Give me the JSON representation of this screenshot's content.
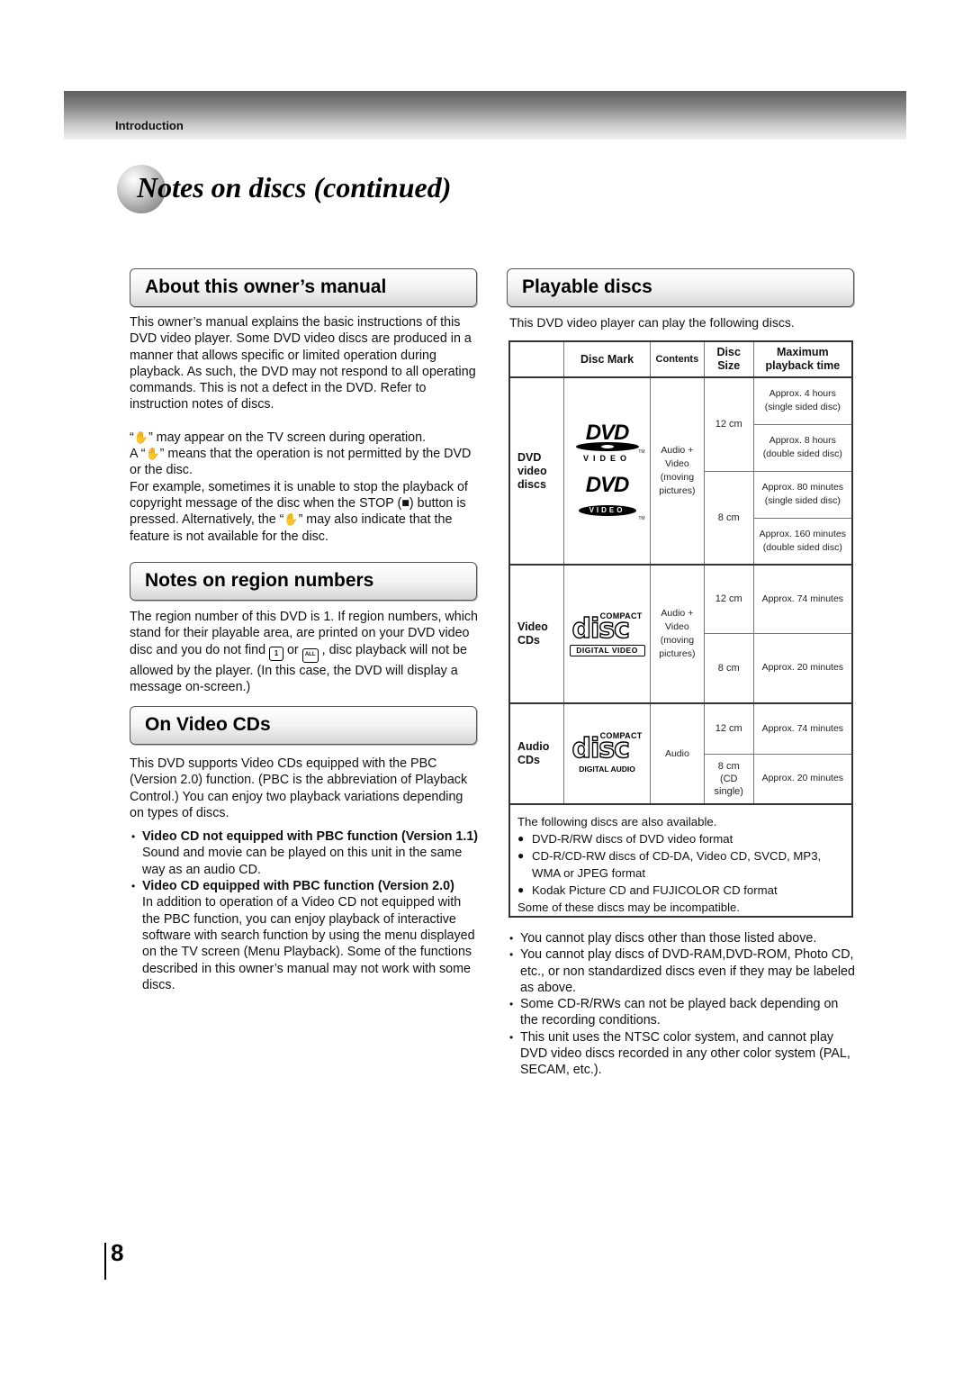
{
  "header": {
    "section_label": "Introduction",
    "page_title": "Notes on discs (continued)"
  },
  "about_manual": {
    "heading": "About this owner’s manual",
    "para1": "This owner’s manual explains the basic instructions of this DVD video player. Some DVD video discs are produced in a manner that allows specific or limited operation during playback. As such, the DVD may not respond to all operating commands. This is not a defect in the DVD. Refer to instruction notes of discs.",
    "hand_icon": "prohibited-hand-icon",
    "line1_pre": "“",
    "line1_post": "” may appear on the TV screen during operation.",
    "line2_pre": "A “",
    "line2_post": "” means that the operation is not permitted by the DVD or the disc.",
    "line3_pre": "For example, sometimes it is unable to stop the playback of copyright message of the disc when the STOP (",
    "stop_icon": "stop-square-icon",
    "line3_mid": ") button is pressed. Alternatively, the “",
    "line3_post": "” may also indicate that the feature is not available for the disc."
  },
  "region": {
    "heading": "Notes on region numbers",
    "text_pre": "The region number of this DVD is 1. If region numbers, which stand for their playable area, are printed on your DVD video disc and you do not find ",
    "region1_icon": "region-1-globe-icon",
    "region1_label": "1",
    "text_or": " or ",
    "regionall_icon": "region-all-globe-icon",
    "regionall_label": "ALL",
    "text_post": " , disc playback will not be allowed by the player. (In this case, the DVD will display a message on-screen.)"
  },
  "video_cds": {
    "heading": "On Video CDs",
    "intro": "This DVD supports Video CDs equipped with the PBC (Version 2.0) function. (PBC is the abbreviation of Playback Control.) You can enjoy two playback variations depending on types of discs.",
    "items": [
      {
        "title": "Video CD not equipped with PBC function (Version 1.1)",
        "desc": "Sound and movie can be played on this unit in the same way as an audio CD."
      },
      {
        "title": "Video CD equipped with PBC function (Version 2.0)",
        "desc": "In addition to operation of a Video CD not equipped with the PBC function, you can enjoy playback of interactive software with search function by using the menu displayed on the TV screen (Menu Playback). Some of the functions described in this owner’s manual may not work with some discs."
      }
    ]
  },
  "playable": {
    "heading": "Playable discs",
    "intro": "This DVD video player can play the following discs.",
    "table": {
      "headers": [
        "",
        "Disc Mark",
        "Contents",
        "Disc Size",
        "Maximum playback time"
      ],
      "groups": [
        {
          "type": "DVD video discs",
          "logo": "dvd-video-logo",
          "logo_text": "DVD",
          "logo_sub": "VIDEO",
          "logo_tm": "TM",
          "contents": "Audio + Video (moving pictures)",
          "sizes": [
            {
              "size": "12 cm",
              "times": [
                "Approx. 4 hours (single sided disc)",
                "Approx. 8 hours (double sided disc)"
              ]
            },
            {
              "size": "8 cm",
              "times": [
                "Approx. 80 minutes (single sided disc)",
                "Approx. 160 minutes (double sided disc)"
              ]
            }
          ]
        },
        {
          "type": "Video CDs",
          "logo": "compact-disc-digital-video-logo",
          "logo_top": "COMPACT",
          "logo_text": "disc",
          "logo_sub": "DIGITAL VIDEO",
          "contents": "Audio + Video (moving pictures)",
          "sizes": [
            {
              "size": "12 cm",
              "times": [
                "Approx. 74 minutes"
              ]
            },
            {
              "size": "8 cm",
              "times": [
                "Approx. 20 minutes"
              ]
            }
          ]
        },
        {
          "type": "Audio CDs",
          "logo": "compact-disc-digital-audio-logo",
          "logo_top": "COMPACT",
          "logo_text": "disc",
          "logo_sub": "DIGITAL AUDIO",
          "contents": "Audio",
          "sizes": [
            {
              "size": "12 cm",
              "times": [
                "Approx. 74 minutes"
              ]
            },
            {
              "size": "8 cm (CD single)",
              "times": [
                "Approx. 20 minutes"
              ]
            }
          ]
        }
      ]
    },
    "also_available": {
      "intro": "The following discs are also available.",
      "items": [
        "DVD-R/RW discs of DVD video format",
        "CD-R/CD-RW discs of CD-DA, Video CD, SVCD, MP3, WMA or JPEG format",
        "Kodak Picture CD and FUJICOLOR CD format"
      ],
      "footer": "Some of these discs may be incompatible."
    },
    "notes": [
      "You cannot play discs other than those listed above.",
      "You cannot play discs of DVD-RAM,DVD-ROM, Photo CD, etc., or non standardized discs even if they may be labeled as above.",
      "Some CD-R/RWs can not be played back depending on the recording conditions.",
      "This unit uses the NTSC color system, and cannot play DVD video discs recorded in any other color system (PAL, SECAM, etc.)."
    ]
  },
  "footer": {
    "page_number": "8"
  }
}
